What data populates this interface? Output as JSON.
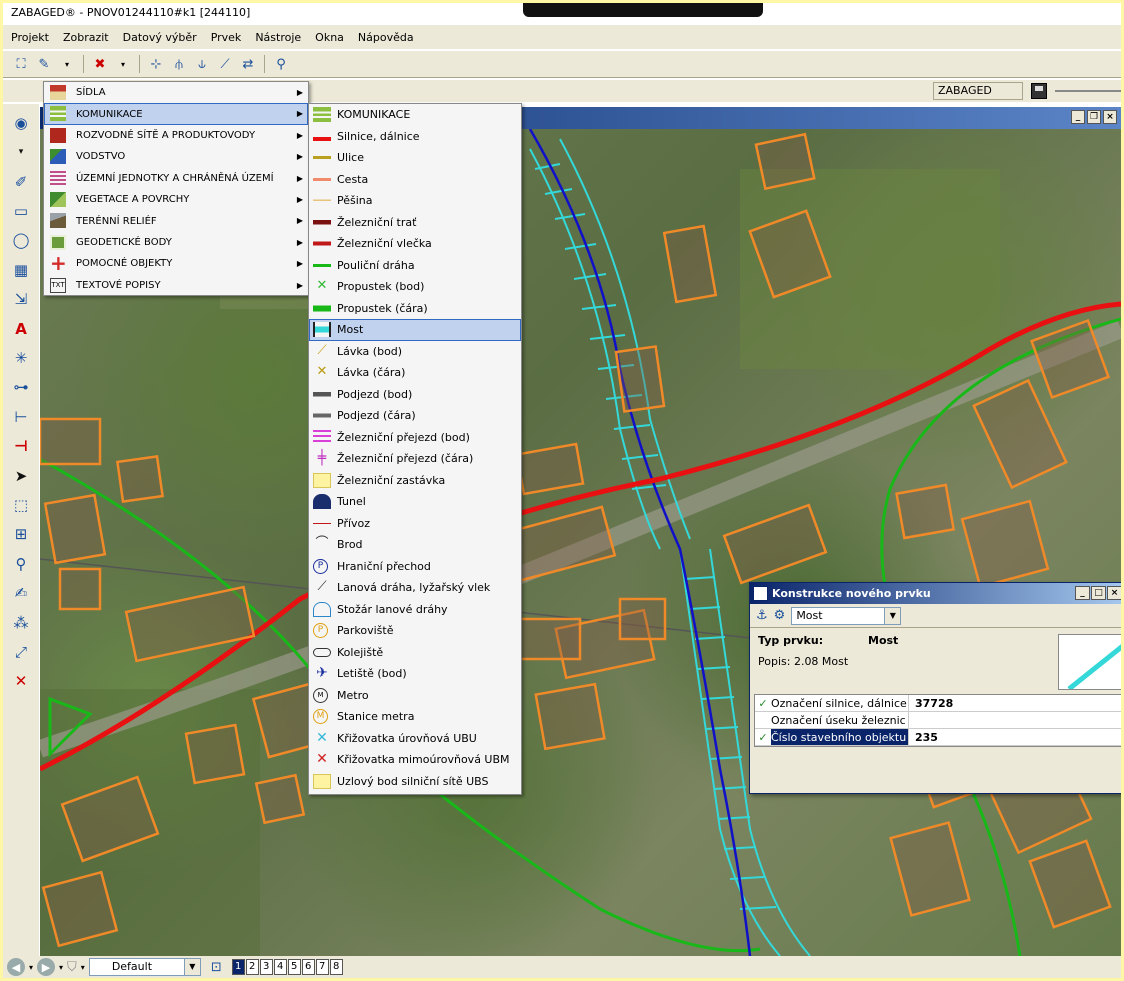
{
  "window": {
    "title": "ZABAGED® - PNOV01244110#k1 [244110]"
  },
  "menubar": [
    "Projekt",
    "Zobrazit",
    "Datový výběr",
    "Prvek",
    "Nástroje",
    "Okna",
    "Nápověda"
  ],
  "status": {
    "database_label": "ZABAGED"
  },
  "category_menu": [
    {
      "label": "SÍDLA",
      "icon": "house-icon",
      "color": "#c0392b"
    },
    {
      "label": "KOMUNIKACE",
      "icon": "road-icon",
      "color": "#8cbf3f",
      "highlighted": true
    },
    {
      "label": "ROZVODNÉ SÍTĚ A PRODUKTOVODY",
      "icon": "pipeline-icon",
      "color": "#b0281d"
    },
    {
      "label": "VODSTVO",
      "icon": "water-icon",
      "color": "#2b5db8"
    },
    {
      "label": "ÚZEMNÍ JEDNOTKY A CHRÁNĚNÁ ÚZEMÍ",
      "icon": "boundary-icon",
      "color": "#c04f8a"
    },
    {
      "label": "VEGETACE A POVRCHY",
      "icon": "vegetation-icon",
      "color": "#3e8c2f"
    },
    {
      "label": "TERÉNNÍ RELIÉF",
      "icon": "terrain-icon",
      "color": "#6b5b3b"
    },
    {
      "label": "GEODETICKÉ BODY",
      "icon": "survey-point-icon",
      "color": "#6b9c3c"
    },
    {
      "label": "POMOCNÉ OBJEKTY",
      "icon": "plus-icon",
      "color": "#d42b2b"
    },
    {
      "label": "TEXTOVÉ POPISY",
      "icon": "text-icon",
      "color": "#444444"
    }
  ],
  "komunikace_menu": [
    {
      "label": "KOMUNIKACE",
      "icon": "road-header-icon"
    },
    {
      "label": "Silnice, dálnice",
      "icon": "highway-icon"
    },
    {
      "label": "Ulice",
      "icon": "street-icon"
    },
    {
      "label": "Cesta",
      "icon": "path-icon"
    },
    {
      "label": "Pěšina",
      "icon": "footpath-icon"
    },
    {
      "label": "Železniční trať",
      "icon": "railway-icon"
    },
    {
      "label": "Železniční vlečka",
      "icon": "railway-siding-icon"
    },
    {
      "label": "Pouliční dráha",
      "icon": "tramway-icon"
    },
    {
      "label": "Propustek (bod)",
      "icon": "culvert-point-icon"
    },
    {
      "label": "Propustek (čára)",
      "icon": "culvert-line-icon"
    },
    {
      "label": "Most",
      "icon": "bridge-icon",
      "highlighted": true
    },
    {
      "label": "Lávka (bod)",
      "icon": "footbridge-point-icon"
    },
    {
      "label": "Lávka (čára)",
      "icon": "footbridge-line-icon"
    },
    {
      "label": "Podjezd (bod)",
      "icon": "underpass-point-icon"
    },
    {
      "label": "Podjezd (čára)",
      "icon": "underpass-line-icon"
    },
    {
      "label": "Železniční přejezd (bod)",
      "icon": "level-crossing-point-icon"
    },
    {
      "label": "Železniční přejezd (čára)",
      "icon": "level-crossing-line-icon"
    },
    {
      "label": "Železniční zastávka",
      "icon": "railway-stop-icon"
    },
    {
      "label": "Tunel",
      "icon": "tunnel-icon"
    },
    {
      "label": "Přívoz",
      "icon": "ferry-icon"
    },
    {
      "label": "Brod",
      "icon": "ford-icon"
    },
    {
      "label": "Hraniční přechod",
      "icon": "border-crossing-icon"
    },
    {
      "label": "Lanová dráha, lyžařský vlek",
      "icon": "cableway-icon"
    },
    {
      "label": "Stožár lanové dráhy",
      "icon": "cableway-pylon-icon"
    },
    {
      "label": "Parkoviště",
      "icon": "parking-icon"
    },
    {
      "label": "Kolejiště",
      "icon": "railyard-icon"
    },
    {
      "label": "Letiště (bod)",
      "icon": "airport-icon"
    },
    {
      "label": "Metro",
      "icon": "metro-icon"
    },
    {
      "label": "Stanice metra",
      "icon": "metro-station-icon"
    },
    {
      "label": "Křižovatka úrovňová UBU",
      "icon": "level-junction-icon"
    },
    {
      "label": "Křižovatka mimoúrovňová UBM",
      "icon": "grade-separated-junction-icon"
    },
    {
      "label": "Uzlový bod silniční sítě UBS",
      "icon": "road-node-icon"
    }
  ],
  "dialog": {
    "title": "Konstrukce nového prvku",
    "type_select": "Most",
    "type_label": "Typ prvku:",
    "type_value": "Most",
    "description": "Popis:  2.08 Most",
    "attributes": [
      {
        "name": "Označení silnice, dálnice",
        "value": "37728",
        "checked": true
      },
      {
        "name": "Označení  úseku železnic",
        "value": "",
        "checked": false
      },
      {
        "name": "Číslo stavebního objektu",
        "value": "235",
        "checked": true,
        "selected": true
      }
    ]
  },
  "bottombar": {
    "layer_select": "Default",
    "pages": [
      "1",
      "2",
      "3",
      "4",
      "5",
      "6",
      "7",
      "8"
    ],
    "active_page": "1"
  },
  "colors": {
    "highway": "#e81010",
    "stream": "#1010c8",
    "buildings": "#f08a28",
    "boundary": "#18b818",
    "embankment": "#34d8d8"
  }
}
